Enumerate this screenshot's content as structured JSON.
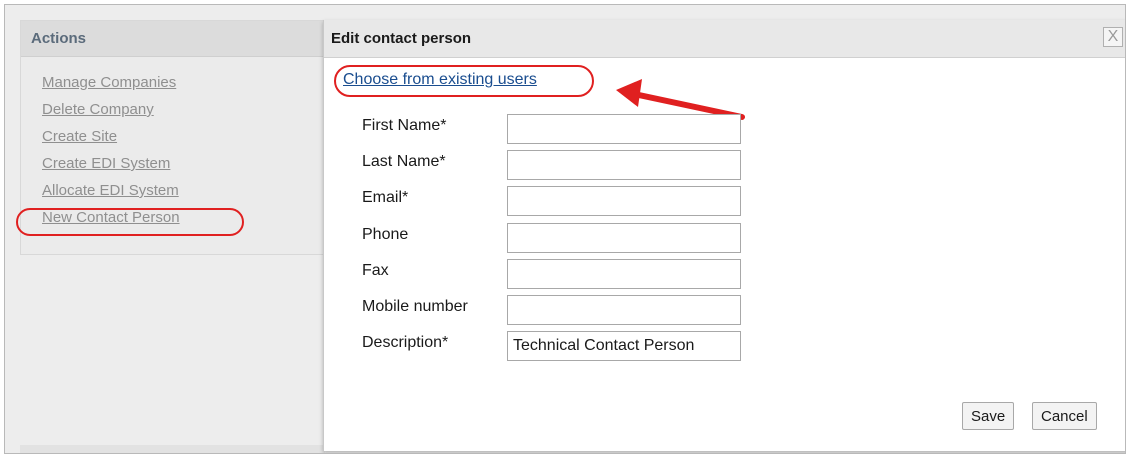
{
  "actions": {
    "title": "Actions",
    "items": [
      {
        "label": "Manage Companies"
      },
      {
        "label": "Delete Company"
      },
      {
        "label": "Create Site"
      },
      {
        "label": "Create EDI System"
      },
      {
        "label": "Allocate EDI System"
      },
      {
        "label": "New Contact Person"
      }
    ]
  },
  "dialog": {
    "title": "Edit contact person",
    "choose_link": "Choose from existing users",
    "fields": [
      {
        "label": "First Name*",
        "value": ""
      },
      {
        "label": "Last Name*",
        "value": ""
      },
      {
        "label": "Email*",
        "value": ""
      },
      {
        "label": "Phone",
        "value": ""
      },
      {
        "label": "Fax",
        "value": ""
      },
      {
        "label": "Mobile number",
        "value": ""
      },
      {
        "label": "Description*",
        "value": "Technical Contact Person"
      }
    ],
    "save_label": "Save",
    "cancel_label": "Cancel",
    "close_glyph": "X"
  },
  "colors": {
    "annotation_red": "#e02020",
    "link_blue": "#1a4d8f",
    "panel_gray": "#ebebeb"
  }
}
